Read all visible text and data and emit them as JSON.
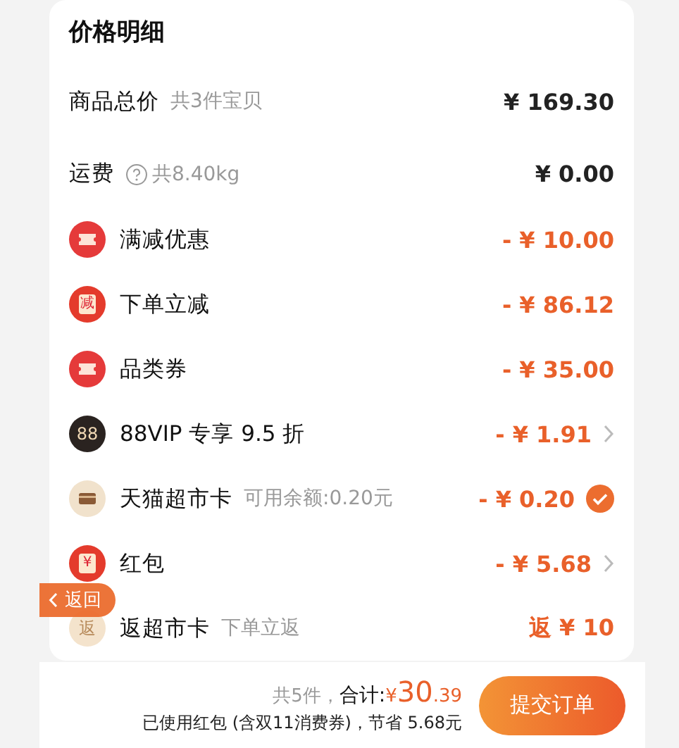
{
  "title": "价格明细",
  "summary_rows": [
    {
      "label": "商品总价",
      "note": "共3件宝贝",
      "help": false,
      "amount": "¥ 169.30"
    },
    {
      "label": "运费",
      "note": "共8.40kg",
      "help": true,
      "amount": "¥ 0.00"
    }
  ],
  "discount_rows": [
    {
      "icon": {
        "kind": "ticket"
      },
      "label": "满减优惠",
      "amount": "- ¥ 10.00",
      "kind": "plain"
    },
    {
      "icon": {
        "kind": "box",
        "text": "减"
      },
      "label": "下单立减",
      "amount": "- ¥ 86.12",
      "kind": "plain"
    },
    {
      "icon": {
        "kind": "ticket"
      },
      "label": "品类券",
      "amount": "- ¥ 35.00",
      "kind": "plain"
    },
    {
      "icon": {
        "kind": "vip",
        "text": "88"
      },
      "label": "88VIP 专享 9.5 折",
      "amount": "- ¥ 1.91",
      "kind": "chevron"
    },
    {
      "icon": {
        "kind": "card"
      },
      "label": "天猫超市卡",
      "note": "可用余额:0.20元",
      "amount": "- ¥ 0.20",
      "kind": "check",
      "checked": true
    },
    {
      "icon": {
        "kind": "box",
        "text": "¥"
      },
      "label": "红包",
      "amount": "- ¥ 5.68",
      "kind": "chevron"
    },
    {
      "icon": {
        "kind": "rebate",
        "text": "返"
      },
      "label": "返超市卡",
      "note": "下单立返",
      "amount": "返 ¥ 10",
      "kind": "plain"
    }
  ],
  "back_button": {
    "label": "返回"
  },
  "footer": {
    "count": "共5件，",
    "total_label": "合计:",
    "currency": "¥ ",
    "integer": "30",
    "decimal": ".39",
    "note": "已使用红包 (含双11消费券)，节省 5.68元",
    "submit": "提交订单"
  }
}
